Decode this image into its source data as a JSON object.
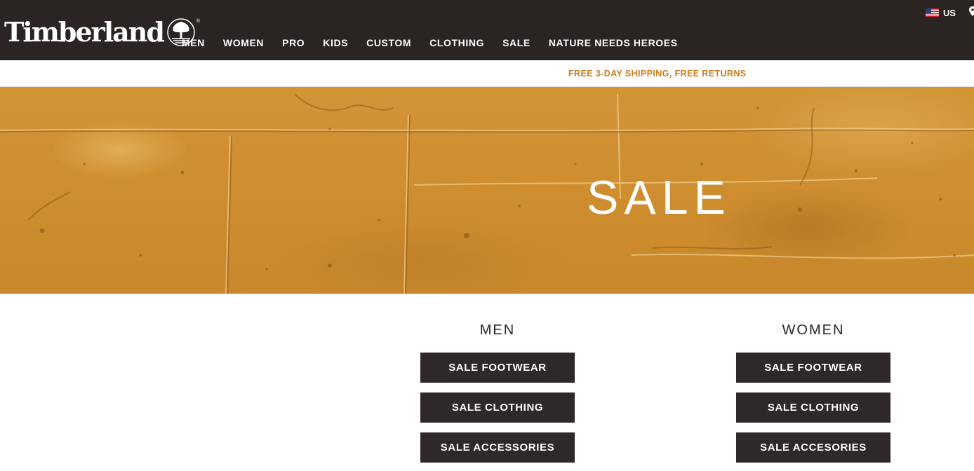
{
  "header": {
    "logo_text": "Timberland",
    "logo_reg": "®",
    "nav": [
      {
        "label": "MEN"
      },
      {
        "label": "WOMEN"
      },
      {
        "label": "PRO"
      },
      {
        "label": "KIDS"
      },
      {
        "label": "CUSTOM"
      },
      {
        "label": "CLOTHING"
      },
      {
        "label": "SALE"
      },
      {
        "label": "NATURE NEEDS HEROES"
      }
    ],
    "locale": "US",
    "flag_icon": "us-flag-icon",
    "pin_icon": "location-pin-icon"
  },
  "promo": {
    "text": "FREE 3-DAY SHIPPING, FREE RETURNS"
  },
  "hero": {
    "title": "SALE"
  },
  "categories": {
    "men": {
      "heading": "MEN",
      "buttons": [
        "SALE FOOTWEAR",
        "SALE CLOTHING",
        "SALE ACCESSORIES"
      ]
    },
    "women": {
      "heading": "WOMEN",
      "buttons": [
        "SALE FOOTWEAR",
        "SALE CLOTHING",
        "SALE ACCESORIES"
      ]
    }
  },
  "colors": {
    "header_bg": "#2a2422",
    "promo_text": "#c87c1e",
    "hero_bg": "#cf8e2f",
    "button_bg": "#2e2828"
  }
}
